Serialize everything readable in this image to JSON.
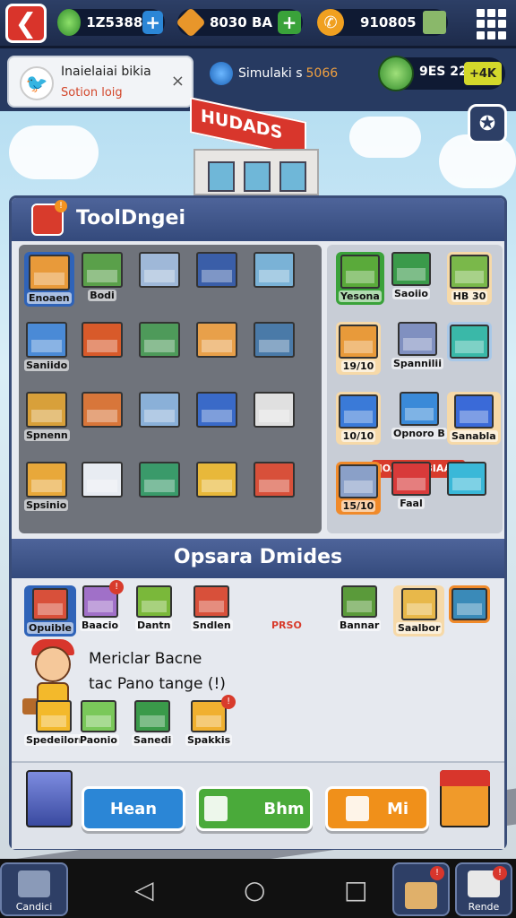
{
  "topbar": {
    "back_icon": "arrow-left-icon",
    "resources": [
      {
        "icon": "gem-icon",
        "value": "1Z5388",
        "plus": "+",
        "plus_color": "#2b86d6"
      },
      {
        "icon": "gold-bar-icon",
        "value": "8030 BA",
        "plus": "+",
        "plus_color": "#3aa23a"
      },
      {
        "icon": "phone-icon",
        "value": "910805",
        "plus": "",
        "plus_color": ""
      }
    ],
    "menu_icon": "grid-menu-icon"
  },
  "notification": {
    "title": "Inaielaiai bikia",
    "subtitle": "Sotion loig",
    "close": "×"
  },
  "simulation": {
    "label": "Simulaki s",
    "value": "5066"
  },
  "coins": {
    "value": "9ES 220",
    "badge": "+4K"
  },
  "store": {
    "sign": "HUDADS"
  },
  "panel": {
    "title": "ToolDngei",
    "badge": "!",
    "left_tiles": [
      {
        "label": "Enoaen",
        "color": "#e89a3a"
      },
      {
        "label": "Bodi",
        "color": "#5aa04a"
      },
      {
        "label": "",
        "color": "#9fb8d8"
      },
      {
        "label": "",
        "color": "#3a5ea8"
      },
      {
        "label": "",
        "color": "#7ab2d6"
      },
      {
        "label": "Saniido",
        "color": "#4a8ad6"
      },
      {
        "label": "",
        "color": "#d85a2a"
      },
      {
        "label": "",
        "color": "#4e9a5a"
      },
      {
        "label": "",
        "color": "#e8a04a"
      },
      {
        "label": "",
        "color": "#4a7aa8"
      },
      {
        "label": "Spnenn",
        "color": "#d8a03a"
      },
      {
        "label": "",
        "color": "#d8763a"
      },
      {
        "label": "",
        "color": "#8ab0d8"
      },
      {
        "label": "",
        "color": "#3a6ac8"
      },
      {
        "label": "",
        "color": "#e0e0e0"
      },
      {
        "label": "Spsinio",
        "color": "#e8a83a"
      },
      {
        "label": "",
        "color": "#e8ecf2"
      },
      {
        "label": "",
        "color": "#3a9a6a"
      },
      {
        "label": "",
        "color": "#e8b83a"
      },
      {
        "label": "",
        "color": "#d8503a"
      }
    ],
    "right_tiles": [
      {
        "label": "Yesona",
        "color": "#5aaa3a"
      },
      {
        "label": "Saoiio",
        "color": "#3a9a4a"
      },
      {
        "label": "HB 30",
        "color": "#7ab84a"
      },
      {
        "label": "19/10",
        "color": "#e89a3a"
      },
      {
        "label": "Spannilii",
        "color": "#8090c0"
      },
      {
        "label": "",
        "color": "#3ab8a8"
      },
      {
        "label": "10/10",
        "color": "#3a7ad8"
      },
      {
        "label": "Opnoro B",
        "color": "#3a8ad8"
      },
      {
        "label": "Sanabla",
        "color": "#3a6ad8"
      },
      {
        "label": "15/10",
        "color": "#8aa0c8"
      },
      {
        "label": "Faal",
        "color": "#d83a3a"
      },
      {
        "label": "",
        "color": "#3ab8d8"
      }
    ],
    "banner": "JOASO UBIAAE"
  },
  "section2": {
    "title": "Opsara Dmides",
    "row1": [
      {
        "label": "Opuible",
        "color": "#d8503a",
        "badge": ""
      },
      {
        "label": "Baacio",
        "color": "#a070c8",
        "badge": "!"
      },
      {
        "label": "Dantn",
        "color": "#7ab83a",
        "badge": ""
      },
      {
        "label": "Sndlen",
        "color": "#d8503a",
        "badge": ""
      },
      {
        "label": "",
        "color": "",
        "badge": ""
      },
      {
        "label": "Bannar",
        "color": "#5a9a3a",
        "badge": ""
      },
      {
        "label": "Saalbor",
        "color": "#e8b84a",
        "badge": ""
      },
      {
        "label": "",
        "color": "#3a8ab8",
        "badge": ""
      }
    ],
    "row1_tag": "PRSO",
    "message_line1": "Mericlar Bacne",
    "message_line2": "tac Pano tange (!)",
    "row2": [
      {
        "label": "Spedeilon",
        "color": "#f3b92b",
        "badge": ""
      },
      {
        "label": "Paonio",
        "color": "#7ac85a",
        "badge": ""
      },
      {
        "label": "Sanedi",
        "color": "#3a9a4a",
        "badge": ""
      },
      {
        "label": "Spakkis",
        "color": "#f0b030",
        "badge": "!"
      }
    ]
  },
  "actions": {
    "btn1": "Hean",
    "btn2": "Bhm",
    "btn3": "Mi",
    "btn1_color": "#2b86d6",
    "btn2_color": "#4aaa3a",
    "btn3_color": "#f0901a"
  },
  "bottom_nav": {
    "left_label": "Candici",
    "right1_label": "",
    "right2_label": "Rende",
    "right1_badge": "!",
    "right2_badge": "!",
    "sys_back": "◁",
    "sys_home": "○",
    "sys_recent": "□"
  }
}
